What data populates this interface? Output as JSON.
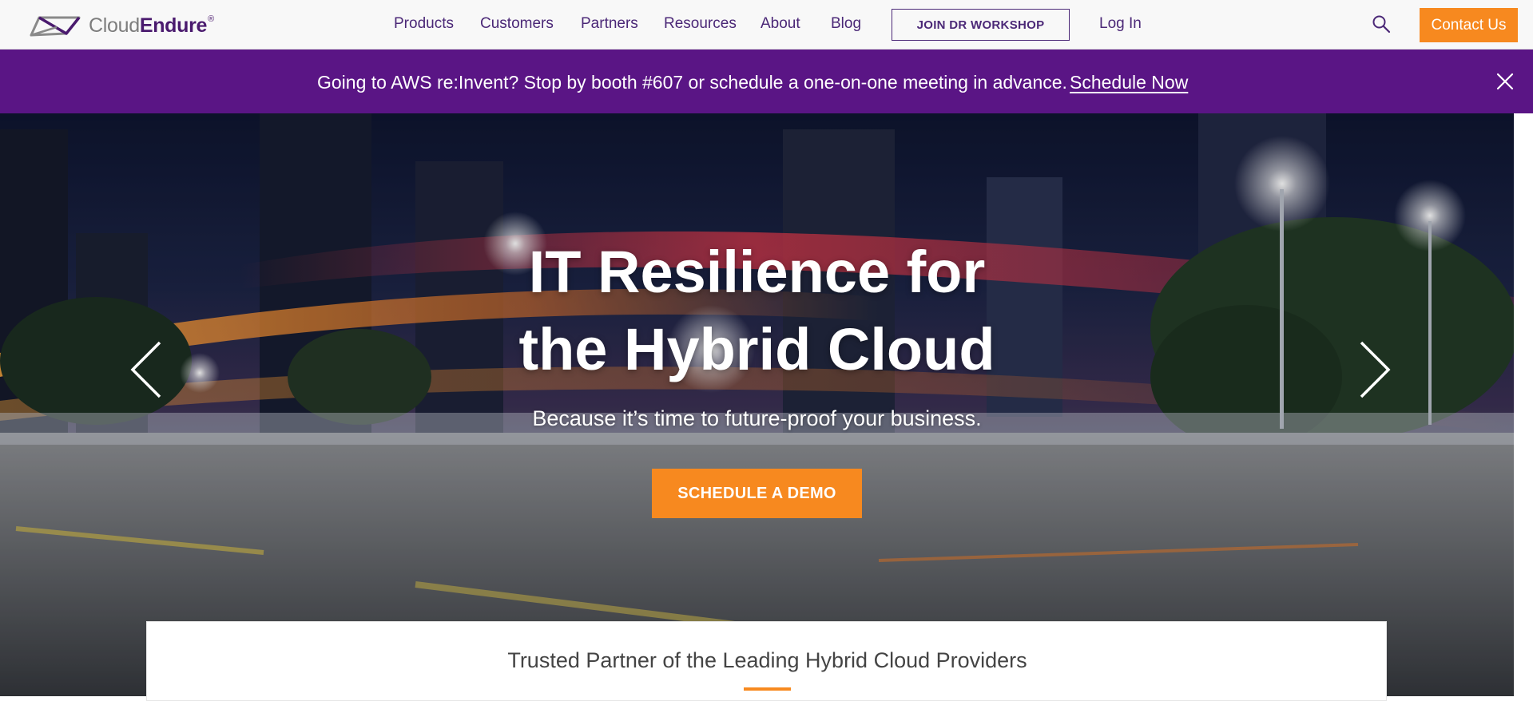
{
  "header": {
    "logo": {
      "name": "Cloud",
      "name_strong": "Endure",
      "registered": "®"
    },
    "nav": {
      "products": "Products",
      "customers": "Customers",
      "partners": "Partners",
      "resources": "Resources",
      "about": "About",
      "blog": "Blog"
    },
    "workshop_button": "JOIN DR WORKSHOP",
    "login": "Log In",
    "search_icon": "search-icon",
    "contact_button": "Contact Us"
  },
  "banner": {
    "text": "Going to AWS re:Invent? Stop by booth #607 or schedule a one-on-one meeting in advance.",
    "link": "Schedule Now",
    "close_icon": "close-icon"
  },
  "hero": {
    "title_line1": "IT Resilience for",
    "title_line2": "the Hybrid Cloud",
    "subtitle": "Because it’s time to future-proof your business.",
    "cta": "SCHEDULE A DEMO",
    "prev_icon": "chevron-left-icon",
    "next_icon": "chevron-right-icon"
  },
  "partners": {
    "title": "Trusted Partner of the Leading Hybrid Cloud Providers"
  },
  "colors": {
    "brand_purple": "#4b2877",
    "banner_purple": "#5a1585",
    "accent_orange": "#f7891f"
  }
}
